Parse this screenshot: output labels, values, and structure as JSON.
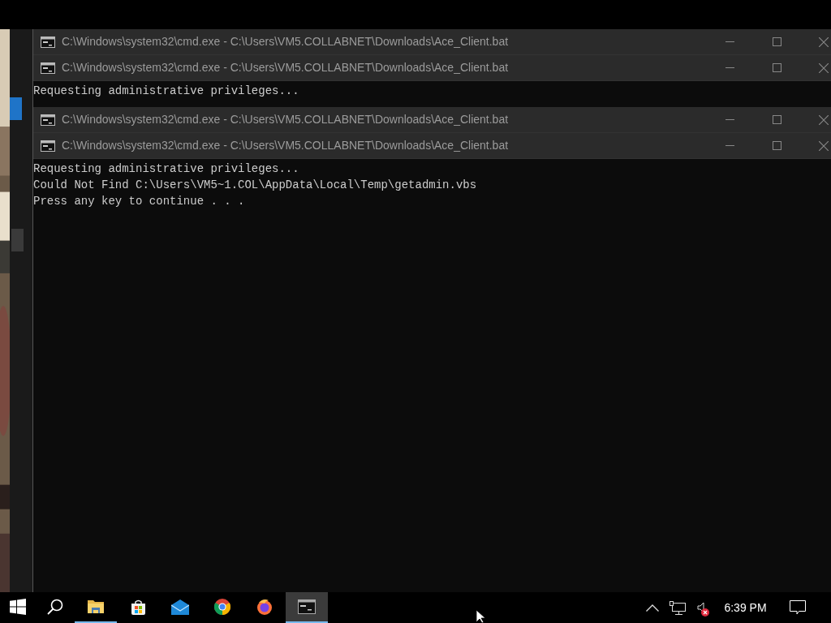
{
  "windows": [
    {
      "title": "C:\\Windows\\system32\\cmd.exe - C:\\Users\\VM5.COLLABNET\\Downloads\\Ace_Client.bat"
    },
    {
      "title": "C:\\Windows\\system32\\cmd.exe - C:\\Users\\VM5.COLLABNET\\Downloads\\Ace_Client.bat",
      "lines": [
        "Requesting administrative privileges..."
      ]
    },
    {
      "title": "C:\\Windows\\system32\\cmd.exe - C:\\Users\\VM5.COLLABNET\\Downloads\\Ace_Client.bat"
    },
    {
      "title": "C:\\Windows\\system32\\cmd.exe - C:\\Users\\VM5.COLLABNET\\Downloads\\Ace_Client.bat",
      "lines": [
        "Requesting administrative privileges...",
        "Could Not Find C:\\Users\\VM5~1.COL\\AppData\\Local\\Temp\\getadmin.vbs",
        "Press any key to continue . . ."
      ]
    }
  ],
  "taskbar": {
    "apps": [
      {
        "kind": "start",
        "running": false,
        "selected": false
      },
      {
        "kind": "search",
        "running": false,
        "selected": false
      },
      {
        "kind": "folder",
        "running": true,
        "selected": false
      },
      {
        "kind": "store",
        "running": false,
        "selected": false
      },
      {
        "kind": "mail",
        "running": false,
        "selected": false
      },
      {
        "kind": "chrome",
        "running": false,
        "selected": false
      },
      {
        "kind": "firefox",
        "running": false,
        "selected": false
      },
      {
        "kind": "console",
        "running": true,
        "selected": true
      }
    ],
    "clock": "6:39 PM",
    "volume_muted": true
  }
}
